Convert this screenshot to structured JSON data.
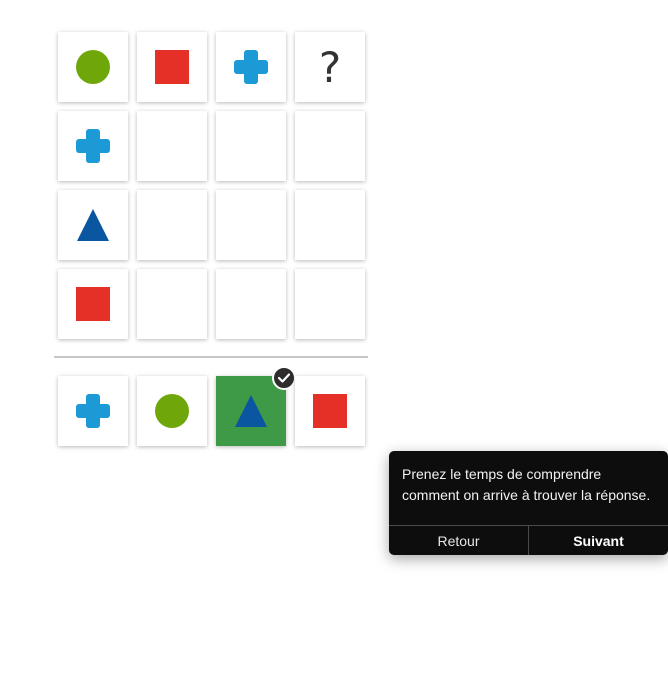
{
  "colors": {
    "green_circle": "#6fa70a",
    "red_square": "#e53027",
    "cyan_cross": "#1c9ad6",
    "blue_triangle": "#0a56a0",
    "selected_bg": "#3f9a47",
    "tooltip_bg": "#0d0d0d"
  },
  "grid": {
    "question_mark": "?",
    "rows": [
      [
        "circle-green",
        "square-red",
        "cross-cyan",
        "question"
      ],
      [
        "cross-cyan",
        "empty",
        "empty",
        "empty"
      ],
      [
        "triangle-blue",
        "empty",
        "empty",
        "empty"
      ],
      [
        "square-red",
        "empty",
        "empty",
        "empty"
      ]
    ]
  },
  "options": {
    "items": [
      "cross-cyan",
      "circle-green",
      "triangle-blue",
      "square-red"
    ],
    "selected_index": 2,
    "selected_badge_icon": "checkmark-icon"
  },
  "tooltip": {
    "text": "Prenez le temps de comprendre comment on arrive à trouver la réponse.",
    "back_label": "Retour",
    "next_label": "Suivant"
  }
}
